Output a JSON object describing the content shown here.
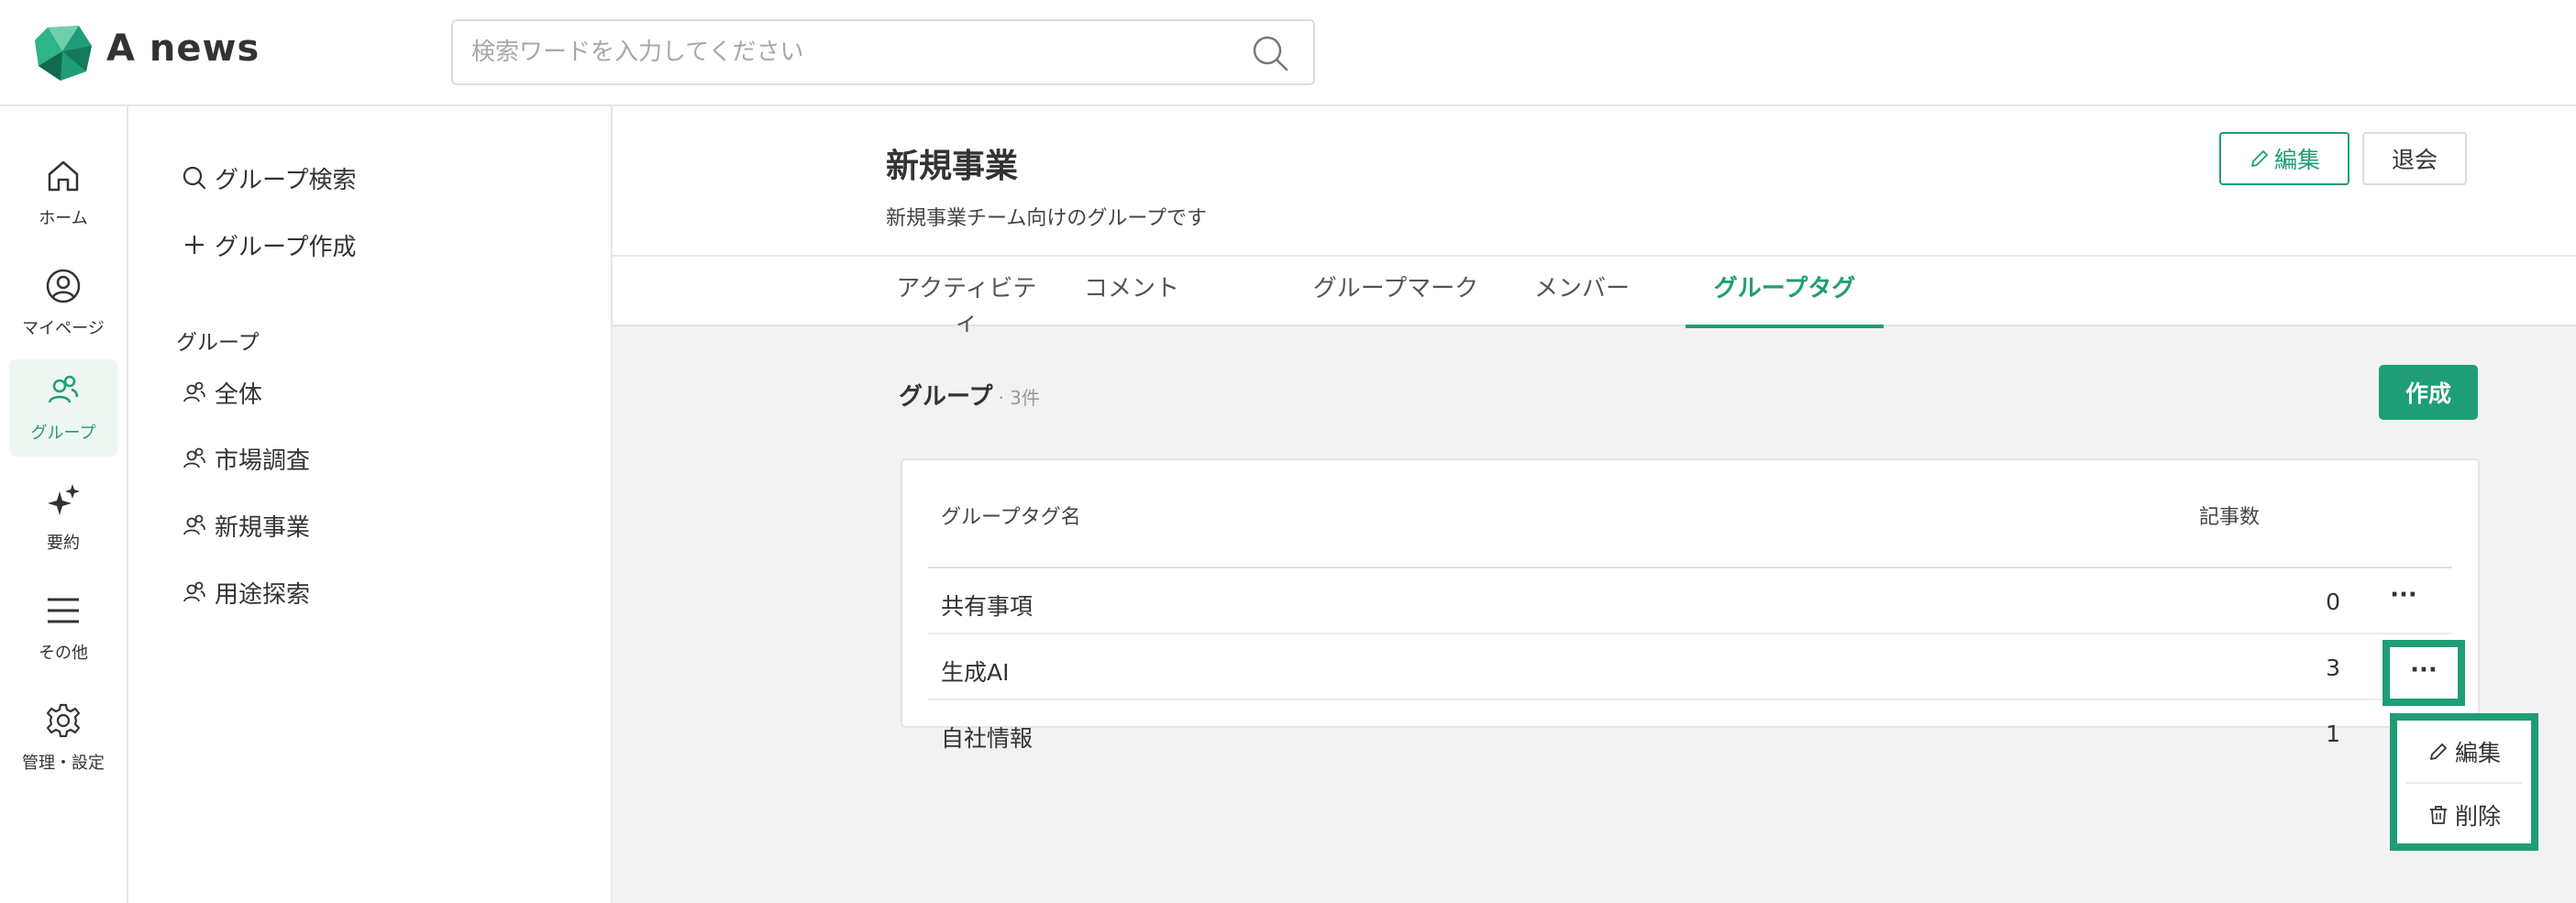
{
  "app": {
    "name": "A news"
  },
  "colors": {
    "accent": "#1f9d77",
    "highlight": "#1f9d77"
  },
  "search": {
    "placeholder": "検索ワードを入力してください",
    "value": ""
  },
  "rail": {
    "items": [
      {
        "label": "ホーム",
        "icon": "home-icon"
      },
      {
        "label": "マイページ",
        "icon": "user-circle-icon"
      },
      {
        "label": "グループ",
        "icon": "group-icon",
        "active": true
      },
      {
        "label": "要約",
        "icon": "sparkle-icon"
      },
      {
        "label": "その他",
        "icon": "menu-icon"
      },
      {
        "label": "管理・設定",
        "icon": "gear-icon"
      }
    ]
  },
  "group_sidebar": {
    "search_label": "グループ検索",
    "create_label": "グループ作成",
    "heading": "グループ",
    "groups": [
      "全体",
      "市場調査",
      "新規事業",
      "用途探索"
    ]
  },
  "main": {
    "title": "新規事業",
    "description": "新規事業チーム向けのグループです",
    "edit_label": "編集",
    "leave_label": "退会",
    "tabs": [
      "アクティビティ",
      "コメント",
      "グループマーク",
      "メンバー",
      "グループタグ"
    ],
    "active_tab": "グループタグ",
    "section_title": "グループ",
    "section_count": "· 3件",
    "create_label": "作成",
    "table": {
      "headers": {
        "name": "グループタグ名",
        "count": "記事数"
      },
      "rows": [
        {
          "name": "共有事項",
          "count": "0"
        },
        {
          "name": "生成AI",
          "count": "3"
        },
        {
          "name": "自社情報",
          "count": "1"
        }
      ],
      "more_label": "···"
    },
    "context_menu": {
      "edit": "編集",
      "delete": "削除"
    }
  }
}
